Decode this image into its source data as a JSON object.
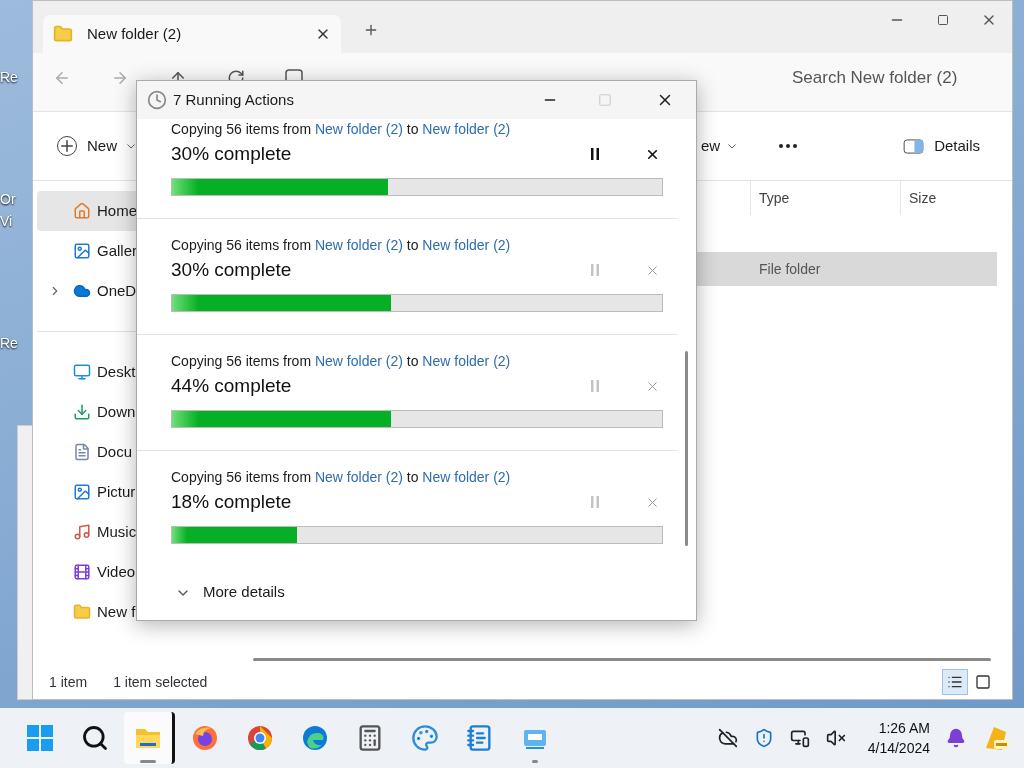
{
  "desktop_icons": [
    {
      "label": "Re"
    },
    {
      "label": "Or Vi"
    },
    {
      "label": "Re"
    }
  ],
  "explorer": {
    "tabs": [
      {
        "title": "New folder (2)",
        "selected": true
      }
    ],
    "search": {
      "placeholder": "Search New folder (2)"
    },
    "toolbar": {
      "new_label": "New",
      "view_label": "ew",
      "details_label": "Details"
    },
    "sidebar": [
      [
        {
          "kind": "home",
          "label": "Home",
          "selected": true
        },
        {
          "kind": "gallery",
          "label": "Galler",
          "selected": false
        },
        {
          "kind": "cloud",
          "label": "OneD",
          "selected": false,
          "expanded": false
        }
      ],
      [
        {
          "kind": "desktop",
          "label": "Deskt",
          "selected": false
        },
        {
          "kind": "download",
          "label": "Down",
          "selected": false
        },
        {
          "kind": "document",
          "label": "Docu",
          "selected": false
        },
        {
          "kind": "gallery",
          "label": "Pictur",
          "selected": false
        },
        {
          "kind": "music",
          "label": "Music",
          "selected": false
        },
        {
          "kind": "video",
          "label": "Video",
          "selected": false
        },
        {
          "kind": "folder",
          "label": "New f",
          "selected": false
        }
      ]
    ],
    "columns": [
      "Type",
      "Size"
    ],
    "rows": [
      {
        "type": "File folder",
        "selected": true
      }
    ],
    "status_bar": {
      "count": "1 item",
      "selection": "1 item selected"
    },
    "views": [
      {
        "kind": "details",
        "selected": true
      },
      {
        "kind": "tiles",
        "selected": false
      }
    ]
  },
  "dialog": {
    "title": "7 Running Actions",
    "operations": [
      {
        "prefix": "Copying 56 items from ",
        "source": "New folder (2)",
        "middle": " to ",
        "target": "New folder (2)",
        "progress": "30% complete",
        "active": true,
        "level": 0.44
      },
      {
        "prefix": "Copying 56 items from ",
        "source": "New folder (2)",
        "middle": " to ",
        "target": "New folder (2)",
        "progress": "30% complete",
        "active": false,
        "level": 0.446
      },
      {
        "prefix": "Copying 56 items from ",
        "source": "New folder (2)",
        "middle": " to ",
        "target": "New folder (2)",
        "progress": "44% complete",
        "active": false,
        "level": 0.446
      },
      {
        "prefix": "Copying 56 items from ",
        "source": "New folder (2)",
        "middle": " to ",
        "target": "New folder (2)",
        "progress": "18% complete",
        "active": false,
        "level": 0.256
      }
    ],
    "more_details": "More details"
  },
  "taskbar": {
    "apps": [
      {
        "kind": "start",
        "selected": false,
        "running": false
      },
      {
        "kind": "search",
        "selected": false,
        "running": false
      },
      {
        "kind": "files",
        "selected": true,
        "running": true
      },
      {
        "kind": "firefox",
        "selected": false,
        "running": false
      },
      {
        "kind": "chrome",
        "selected": false,
        "running": false
      },
      {
        "kind": "edge",
        "selected": false,
        "running": false
      },
      {
        "kind": "calculator",
        "selected": false,
        "running": false
      },
      {
        "kind": "paint",
        "selected": false,
        "running": false
      },
      {
        "kind": "notepad",
        "selected": false,
        "running": false
      },
      {
        "kind": "remote",
        "selected": false,
        "running": true
      }
    ],
    "time": "1:26 AM",
    "date": "4/14/2024"
  }
}
